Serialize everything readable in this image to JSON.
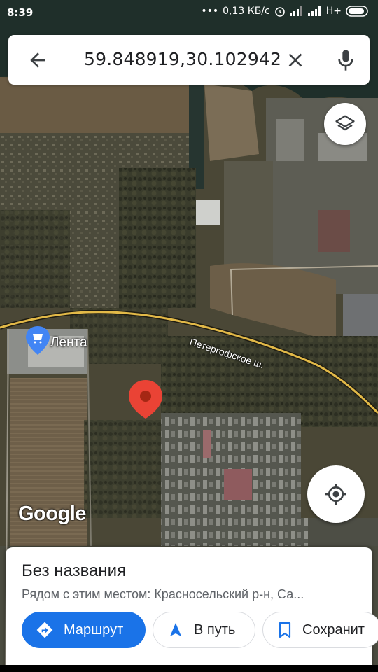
{
  "status_bar": {
    "time": "8:39",
    "network_speed": "0,13 КБ/с",
    "network_type": "H+"
  },
  "search": {
    "query": "59.848919,30.102942"
  },
  "map": {
    "attribution": "Google",
    "poi_label": "Лента",
    "road_label": "Петергофское ш.",
    "marker_color": "#ea4335",
    "poi_color": "#4285f4",
    "road_color": "#e2b948"
  },
  "place_sheet": {
    "title": "Без названия",
    "subtitle": "Рядом с этим местом: Красносельский р-н, Са...",
    "buttons": {
      "route": "Маршрут",
      "start": "В путь",
      "save": "Сохранит"
    },
    "accent": "#1a73e8"
  },
  "icons": [
    "arrow-back-icon",
    "close-icon",
    "mic-icon",
    "layers-icon",
    "my-location-icon",
    "directions-icon",
    "navigation-icon",
    "bookmark-icon"
  ]
}
